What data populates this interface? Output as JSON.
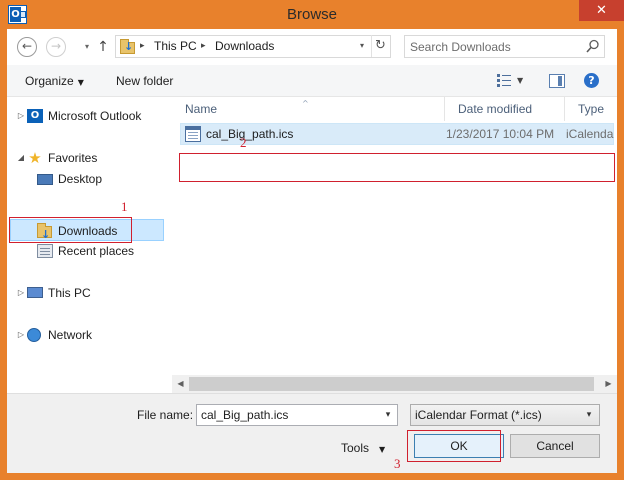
{
  "window": {
    "title": "Browse",
    "close_glyph": "✕",
    "app_icon": "outlook-icon",
    "accent": "#e8812c"
  },
  "nav": {
    "back_glyph": "←",
    "forward_glyph": "→",
    "history_glyph": "▾",
    "up_glyph": "↑"
  },
  "address": {
    "crumbs": [
      "This PC",
      "Downloads"
    ],
    "separator": "▸",
    "dropdown_glyph": "▾",
    "refresh_glyph": "↻"
  },
  "search": {
    "placeholder": "Search Downloads",
    "icon": "magnifier-icon"
  },
  "toolbar": {
    "organize_label": "Organize",
    "organize_arrow": "▼",
    "new_folder_label": "New folder",
    "view_arrow": "▼",
    "help_glyph": "?"
  },
  "sidebar": {
    "items": [
      {
        "label": "Microsoft Outlook",
        "icon": "outlook-icon",
        "expander": "▷"
      },
      {
        "label": "Favorites",
        "icon": "star-icon",
        "expander": "◢"
      },
      {
        "label": "Desktop",
        "icon": "desktop-icon"
      },
      {
        "label": "Downloads",
        "icon": "downloads-folder-icon",
        "selected": true
      },
      {
        "label": "Recent places",
        "icon": "recent-places-icon"
      },
      {
        "label": "This PC",
        "icon": "computer-icon",
        "expander": "▷"
      },
      {
        "label": "Network",
        "icon": "network-icon",
        "expander": "▷"
      }
    ],
    "star_glyph": "★",
    "outlook_glyph": "O"
  },
  "filelist": {
    "columns": [
      "Name",
      "Date modified",
      "Type"
    ],
    "sort_arrow": "^",
    "rows": [
      {
        "name": "cal_Big_path.ics",
        "date_modified": "1/23/2017 10:04 PM",
        "type": "iCalendar"
      }
    ]
  },
  "scrollbar": {
    "left_glyph": "◀",
    "right_glyph": "▶"
  },
  "footer": {
    "file_name_label": "File name:",
    "file_name_value": "cal_Big_path.ics",
    "file_name_drop": "▾",
    "file_type_value": "iCalendar Format (*.ics)",
    "file_type_drop": "▾",
    "tools_label": "Tools",
    "tools_arrow": "▼",
    "ok_label": "OK",
    "cancel_label": "Cancel"
  },
  "annotations": {
    "marker_1": "1",
    "marker_2": "2",
    "marker_3": "3",
    "color": "#d0202e"
  }
}
